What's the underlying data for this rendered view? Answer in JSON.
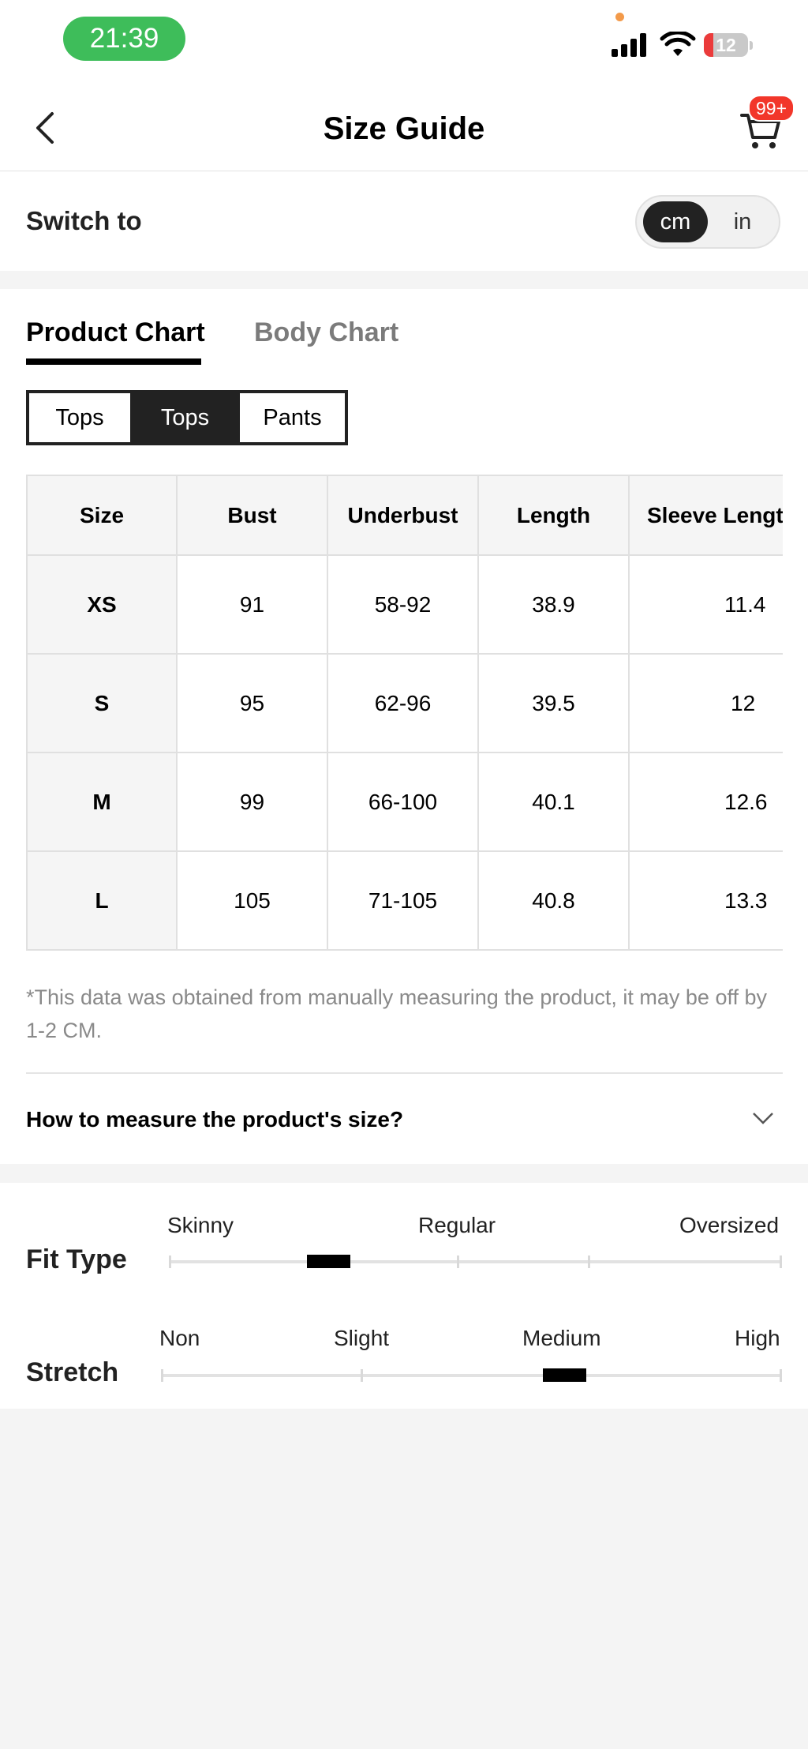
{
  "status": {
    "time": "21:39",
    "battery": "12"
  },
  "header": {
    "title": "Size Guide",
    "cart_badge": "99+"
  },
  "units": {
    "label": "Switch to",
    "options": [
      "cm",
      "in"
    ],
    "selected": "cm"
  },
  "tabs": {
    "product": "Product Chart",
    "body": "Body Chart",
    "active": "Product Chart"
  },
  "categories": {
    "items": [
      "Tops",
      "Tops",
      "Pants"
    ],
    "selected_index": 1
  },
  "table": {
    "headers": [
      "Size",
      "Bust",
      "Underbust",
      "Length",
      "Sleeve Lengt"
    ],
    "rows": [
      [
        "XS",
        "91",
        "58-92",
        "38.9",
        "11.4"
      ],
      [
        "S",
        "95",
        "62-96",
        "39.5",
        "12"
      ],
      [
        "M",
        "99",
        "66-100",
        "40.1",
        "12.6"
      ],
      [
        "L",
        "105",
        "71-105",
        "40.8",
        "13.3"
      ]
    ]
  },
  "note": "*This data was obtained from manually measuring the product, it may be off by 1-2 CM.",
  "measure": {
    "label": "How to measure the product's size?"
  },
  "fit_type": {
    "label": "Fit Type",
    "levels": [
      "Skinny",
      "Regular",
      "Oversized"
    ],
    "position": 0.26
  },
  "stretch": {
    "label": "Stretch",
    "levels": [
      "Non",
      "Slight",
      "Medium",
      "High"
    ],
    "position": 0.65
  },
  "colors": {
    "accent": "#222222",
    "badge": "#f2362a",
    "time_pill": "#3ebd5a",
    "muted": "#7b7b7b"
  }
}
